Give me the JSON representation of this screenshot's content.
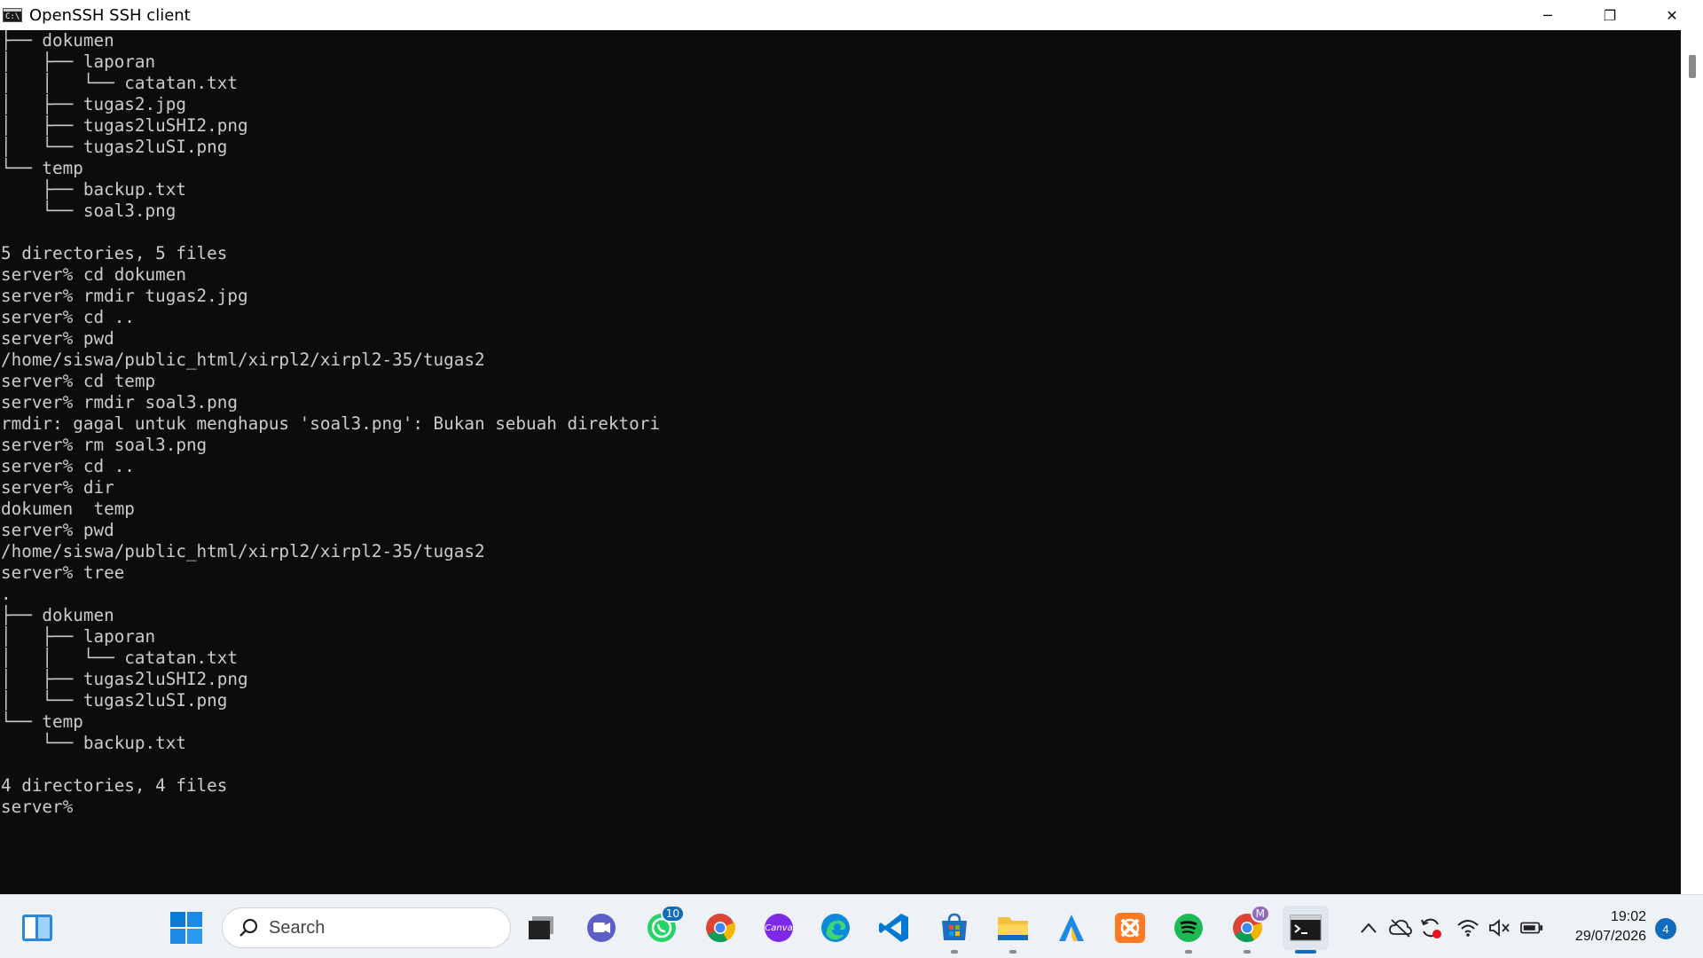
{
  "window": {
    "title": "OpenSSH SSH client",
    "icon_text": "C:\\",
    "minimize_glyph": "─",
    "restore_glyph": "❐",
    "close_glyph": "✕"
  },
  "terminal": {
    "lines": [
      "├── dokumen",
      "│   ├── laporan",
      "│   │   └── catatan.txt",
      "│   ├── tugas2.jpg",
      "│   ├── tugas2luSHI2.png",
      "│   └── tugas2luSI.png",
      "└── temp",
      "    ├── backup.txt",
      "    └── soal3.png",
      "",
      "5 directories, 5 files",
      "server% cd dokumen",
      "server% rmdir tugas2.jpg",
      "server% cd ..",
      "server% pwd",
      "/home/siswa/public_html/xirpl2/xirpl2-35/tugas2",
      "server% cd temp",
      "server% rmdir soal3.png",
      "rmdir: gagal untuk menghapus 'soal3.png': Bukan sebuah direktori",
      "server% rm soal3.png",
      "server% cd ..",
      "server% dir",
      "dokumen  temp",
      "server% pwd",
      "/home/siswa/public_html/xirpl2/xirpl2-35/tugas2",
      "server% tree",
      ".",
      "├── dokumen",
      "│   ├── laporan",
      "│   │   └── catatan.txt",
      "│   ├── tugas2luSHI2.png",
      "│   └── tugas2luSI.png",
      "└── temp",
      "    └── backup.txt",
      "",
      "4 directories, 4 files",
      "server% "
    ]
  },
  "taskbar": {
    "search_placeholder": "Search",
    "whatsapp_badge": "10",
    "chrome_profile_badge": "M",
    "canva_label": "Canva",
    "clock_time": "19:02",
    "clock_date": "29/07/2026",
    "notification_count": "4",
    "colors": {
      "accent": "#0f6cbd",
      "whatsapp": "#25d366",
      "spotify": "#1db954",
      "vscode": "#0078d4",
      "xampp": "#fb7a24",
      "canva": "#7d2ae8",
      "edge": "#0c8bd8",
      "explorer": "#f3c13a"
    }
  }
}
